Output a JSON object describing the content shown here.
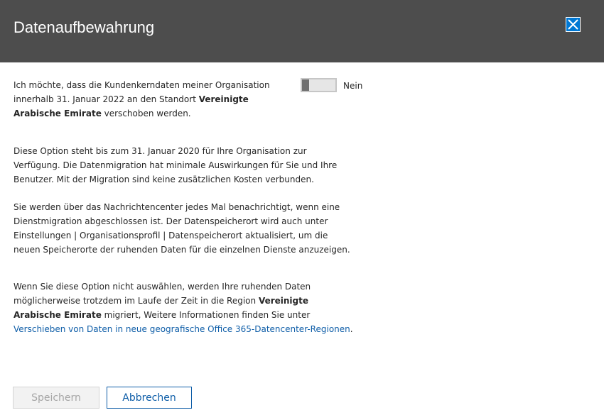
{
  "dialog": {
    "title": "Datenaufbewahrung"
  },
  "option": {
    "text_a": "Ich möchte, dass die Kundenkerndaten meiner Organisation innerhalb 31. Januar 2022 an den Standort ",
    "region": "Vereinigte Arabische Emirate",
    "text_b": " verschoben werden.",
    "toggle_state": "Nein",
    "toggle_on": false
  },
  "info": {
    "p1": "Diese Option steht bis zum 31. Januar 2020 für Ihre Organisation zur Verfügung. Die Datenmigration hat minimale Auswirkungen für Sie und Ihre Benutzer. Mit der Migration sind keine zusätzlichen Kosten verbunden.",
    "p2": "Sie werden über das Nachrichtencenter jedes Mal benachrichtigt, wenn eine Dienstmigration abgeschlossen ist. Der Datenspeicherort wird auch unter Einstellungen | Organisationsprofil | Datenspeicherort aktualisiert, um die neuen Speicherorte der ruhenden Daten für die einzelnen Dienste anzuzeigen.",
    "p3_a": "Wenn Sie diese Option nicht auswählen, werden Ihre ruhenden Daten möglicherweise trotzdem im Laufe der Zeit in die Region ",
    "p3_region": "Vereinigte Arabische Emirate",
    "p3_b": " migriert, Weitere Informationen finden Sie unter ",
    "p3_link": "Verschieben von Daten in neue geografische Office 365-Datencenter-Regionen",
    "p3_c": "."
  },
  "buttons": {
    "save": "Speichern",
    "cancel": "Abbrechen"
  },
  "colors": {
    "header_bg": "#4d4d4d",
    "accent": "#0078d4",
    "link": "#0f5ea8"
  }
}
